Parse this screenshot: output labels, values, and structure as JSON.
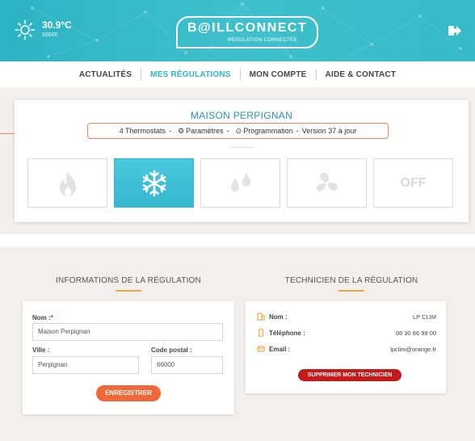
{
  "header": {
    "temperature": "30.9°C",
    "zip": "66600",
    "brand": "B@ILLCONNECT",
    "brand_sub": "RÉGULATION CONNECTÉE",
    "colors": {
      "primary": "#2fb5c6",
      "accent": "#f0683a"
    }
  },
  "nav": {
    "items": [
      {
        "label": "ACTUALITÉS",
        "active": false
      },
      {
        "label": "MES RÉGULATIONS",
        "active": true
      },
      {
        "label": "MON COMPTE",
        "active": false
      },
      {
        "label": "AIDE & CONTACT",
        "active": false
      }
    ]
  },
  "regulation": {
    "name": "MAISON PERPIGNAN",
    "thermostats": "4 Thermostats",
    "sep": "-",
    "parametres": "Paramètres",
    "programmation": "Programmation",
    "version": "Version 37 à jour",
    "modes": [
      {
        "icon": "flame-icon",
        "active": false
      },
      {
        "icon": "snowflake-icon",
        "active": true
      },
      {
        "icon": "droplets-icon",
        "active": false
      },
      {
        "icon": "fan-icon",
        "active": false
      },
      {
        "icon": "off",
        "label": "OFF",
        "active": false
      }
    ]
  },
  "info": {
    "title": "INFORMATIONS DE LA RÉGULATION",
    "nom_label": "Nom :",
    "required_mark": "*",
    "nom_value": "Maison Perpignan",
    "ville_label": "Ville :",
    "ville_value": "Perpignan",
    "cp_label": "Code postal :",
    "cp_value": "66000",
    "save_label": "ENREGISTRER"
  },
  "tech": {
    "title": "TECHNICIEN DE LA RÉGULATION",
    "nom_label": "Nom :",
    "nom_value": "LP CLIM",
    "tel_label": "Téléphone :",
    "tel_value": "06 30 66 99 00",
    "email_label": "Email :",
    "email_value": "lpclim@orange.fr",
    "delete_label": "SUPPRIMER MON TECHNICIEN"
  }
}
